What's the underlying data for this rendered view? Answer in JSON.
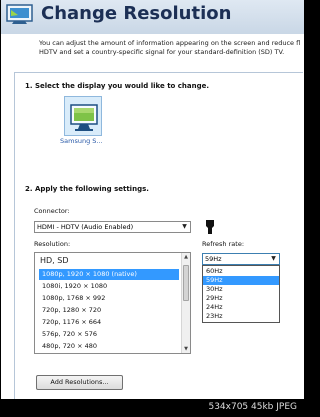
{
  "header": {
    "title": "Change Resolution"
  },
  "description": "You can adjust the amount of information appearing on the screen and reduce fl\nHDTV and set a country-specific signal for your standard-definition (SD) TV.",
  "step1": {
    "label": "1. Select the display you would like to change.",
    "display_name": "Samsung S..."
  },
  "step2": {
    "label": "2. Apply the following settings."
  },
  "connector": {
    "label": "Connector:",
    "value": "HDMI - HDTV (Audio Enabled)"
  },
  "resolution": {
    "label": "Resolution:",
    "group": "HD, SD",
    "items": [
      "1080p, 1920 × 1080 (native)",
      "1080i, 1920 × 1080",
      "1080p, 1768 × 992",
      "720p, 1280 × 720",
      "720p, 1176 × 664",
      "576p, 720 × 576",
      "480p, 720 × 480"
    ],
    "selected_index": 0
  },
  "refresh_rate": {
    "label": "Refresh rate:",
    "value": "59Hz",
    "options": [
      "60Hz",
      "59Hz",
      "30Hz",
      "29Hz",
      "24Hz",
      "23Hz"
    ],
    "selected_index": 1
  },
  "add_button": {
    "label": "Add Resolutions..."
  },
  "footer": {
    "text": "534x705  45kb  JPEG"
  }
}
